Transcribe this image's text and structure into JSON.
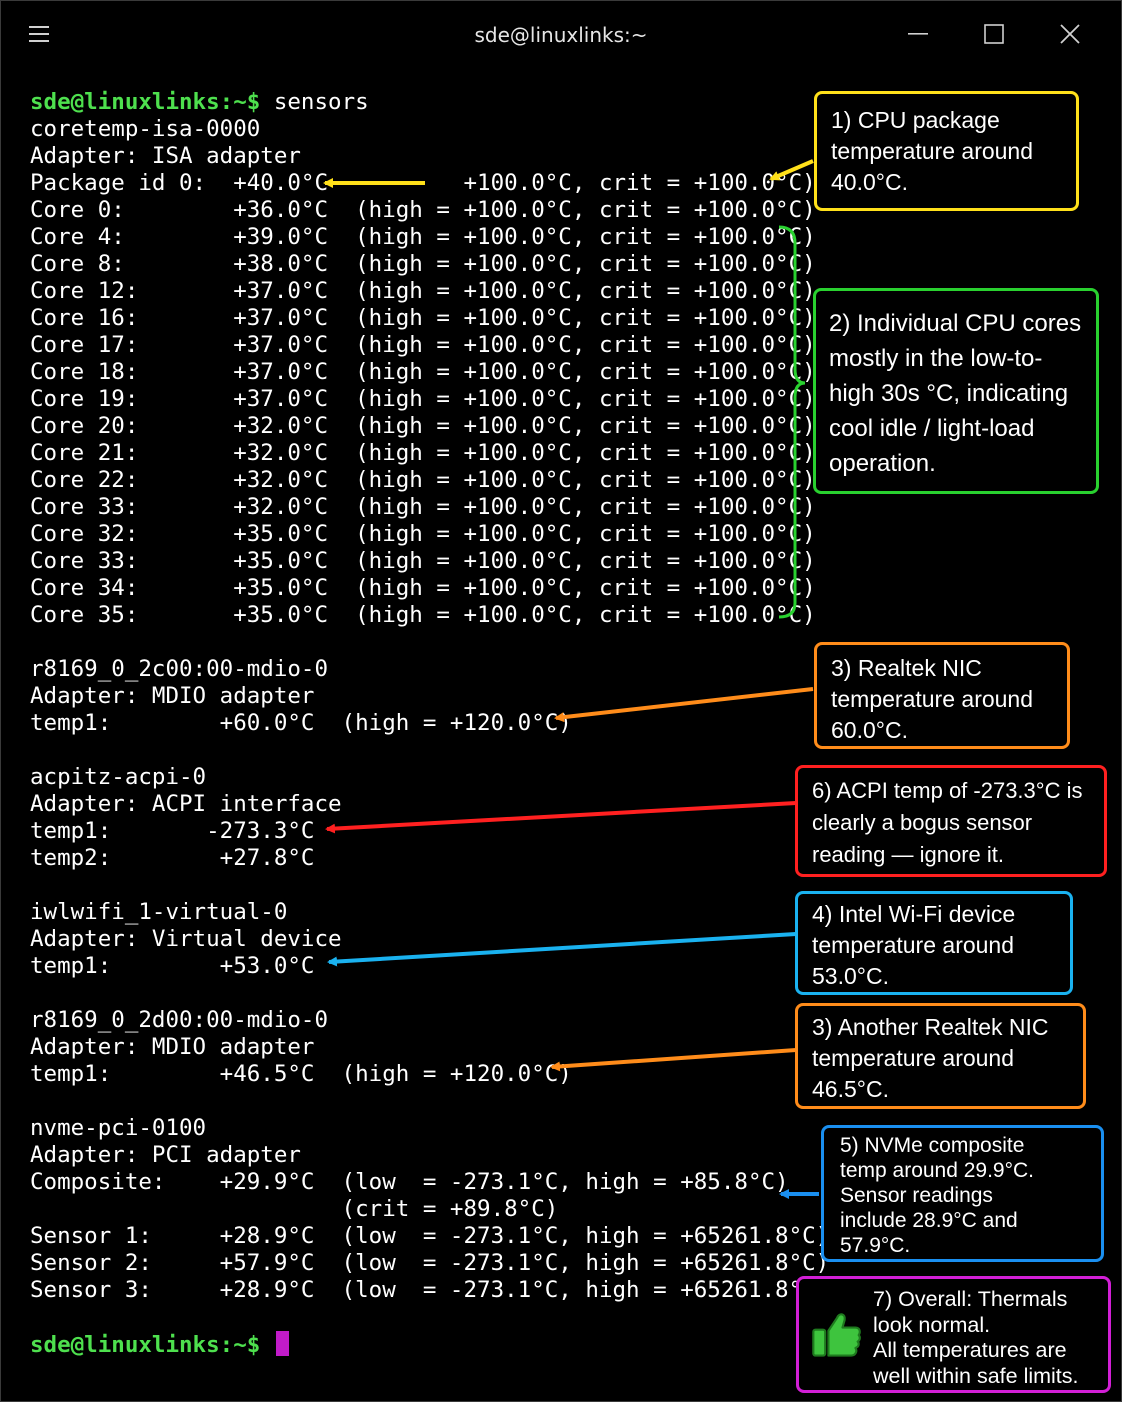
{
  "window": {
    "title": "sde@linuxlinks:~",
    "menu_icon": "hamburger-menu-icon",
    "minimize_icon": "minimize-icon",
    "maximize_icon": "maximize-icon",
    "close_icon": "close-icon"
  },
  "terminal": {
    "prompt": "sde@linuxlinks:~$",
    "command": "sensors",
    "coretemp": {
      "chip": "coretemp-isa-0000",
      "adapter": "Adapter: ISA adapter",
      "package": "Package id 0:  +40.0°C          +100.0°C, crit = +100.0°C)",
      "cores": [
        "Core 0:        +36.0°C  (high = +100.0°C, crit = +100.0°C)",
        "Core 4:        +39.0°C  (high = +100.0°C, crit = +100.0°C)",
        "Core 8:        +38.0°C  (high = +100.0°C, crit = +100.0°C)",
        "Core 12:       +37.0°C  (high = +100.0°C, crit = +100.0°C)",
        "Core 16:       +37.0°C  (high = +100.0°C, crit = +100.0°C)",
        "Core 17:       +37.0°C  (high = +100.0°C, crit = +100.0°C)",
        "Core 18:       +37.0°C  (high = +100.0°C, crit = +100.0°C)",
        "Core 19:       +37.0°C  (high = +100.0°C, crit = +100.0°C)",
        "Core 20:       +32.0°C  (high = +100.0°C, crit = +100.0°C)",
        "Core 21:       +32.0°C  (high = +100.0°C, crit = +100.0°C)",
        "Core 22:       +32.0°C  (high = +100.0°C, crit = +100.0°C)",
        "Core 33:       +32.0°C  (high = +100.0°C, crit = +100.0°C)",
        "Core 32:       +35.0°C  (high = +100.0°C, crit = +100.0°C)",
        "Core 33:       +35.0°C  (high = +100.0°C, crit = +100.0°C)",
        "Core 34:       +35.0°C  (high = +100.0°C, crit = +100.0°C)",
        "Core 35:       +35.0°C  (high = +100.0°C, crit = +100.0°C)"
      ]
    },
    "r8169_2c00": {
      "chip": "r8169_0_2c00:00-mdio-0",
      "adapter": "Adapter: MDIO adapter",
      "temp1": "temp1:        +60.0°C  (high = +120.0°C)"
    },
    "acpitz": {
      "chip": "acpitz-acpi-0",
      "adapter": "Adapter: ACPI interface",
      "temp1": "temp1:       -273.3°C",
      "temp2": "temp2:        +27.8°C"
    },
    "iwlwifi": {
      "chip": "iwlwifi_1-virtual-0",
      "adapter": "Adapter: Virtual device",
      "temp1": "temp1:        +53.0°C"
    },
    "r8169_2d00": {
      "chip": "r8169_0_2d00:00-mdio-0",
      "adapter": "Adapter: MDIO adapter",
      "temp1": "temp1:        +46.5°C  (high = +120.0°C)"
    },
    "nvme": {
      "chip": "nvme-pci-0100",
      "adapter": "Adapter: PCI adapter",
      "composite": "Composite:    +29.9°C  (low  = -273.1°C, high = +85.8°C)",
      "composite_crit": "                       (crit = +89.8°C)",
      "sensors": [
        "Sensor 1:     +28.9°C  (low  = -273.1°C, high = +65261.8°C)",
        "Sensor 2:     +57.9°C  (low  = -273.1°C, high = +65261.8°C)",
        "Sensor 3:     +28.9°C  (low  = -273.1°C, high = +65261.8°C)"
      ]
    }
  },
  "annotations": {
    "n1": {
      "text": "1) CPU package\ntemperature around\n40.0°C.",
      "color": "#ffe01a"
    },
    "n2": {
      "text": "2) Individual CPU cores\nmostly in the low-to-\nhigh 30s °C, indicating\ncool idle / light-load\noperation.",
      "color": "#29d12f"
    },
    "n3": {
      "text": "3) Realtek NIC\ntemperature around\n60.0°C.",
      "color": "#ff8c1a"
    },
    "n6": {
      "text": "6) ACPI temp of -273.3°C is\nclearly a bogus sensor\nreading — ignore it.",
      "color": "#ff2020"
    },
    "n4": {
      "text": "4) Intel Wi-Fi device\ntemperature around\n53.0°C.",
      "color": "#1ab2f0"
    },
    "n3b": {
      "text": "3) Another Realtek NIC\ntemperature around\n46.5°C.",
      "color": "#ff8c1a"
    },
    "n5": {
      "text": "5) NVMe composite\ntemp around 29.9°C.\nSensor readings\ninclude 28.9°C and\n57.9°C.",
      "color": "#1a8ff0"
    },
    "n7": {
      "text": "7) Overall: Thermals\nlook normal.\nAll temperatures are\nwell within safe limits.",
      "color": "#d21fd6",
      "icon": "thumbs-up-icon"
    }
  }
}
